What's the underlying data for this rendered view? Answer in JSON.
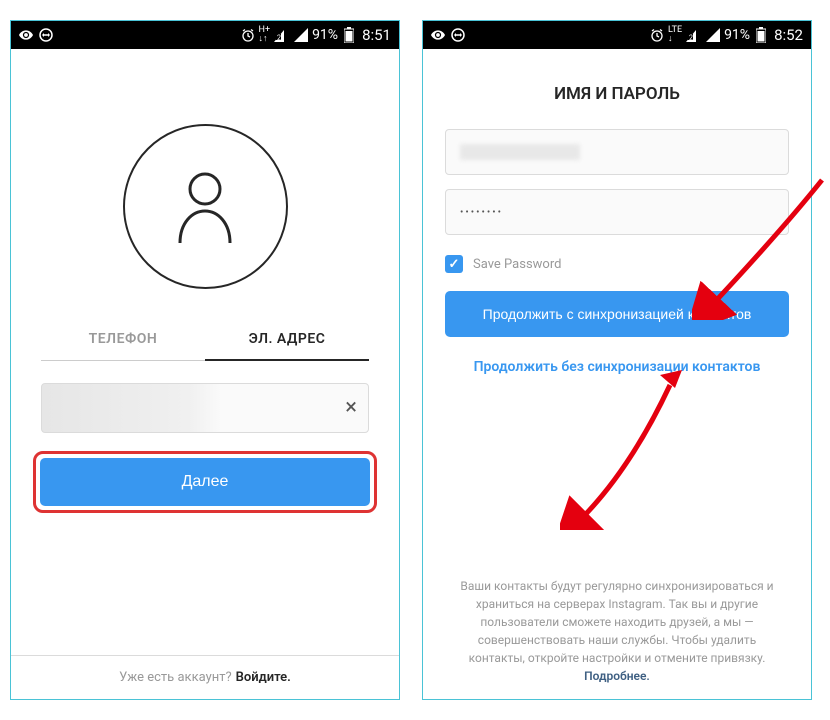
{
  "left": {
    "status": {
      "battery": "91%",
      "time": "8:51"
    },
    "tabs": {
      "phone": "ТЕЛЕФОН",
      "email": "ЭЛ. АДРЕС"
    },
    "input_placeholder": "",
    "next_button": "Далее",
    "footer_text": "Уже есть аккаунт?",
    "footer_link": "Войдите."
  },
  "right": {
    "status": {
      "battery": "91%",
      "time": "8:52"
    },
    "heading": "ИМЯ И ПАРОЛЬ",
    "password_dots": "••••••••",
    "save_password_label": "Save Password",
    "continue_sync": "Продолжить с синхронизацией контактов",
    "continue_no_sync": "Продолжить без синхронизации контактов",
    "disclaimer_text": "Ваши контакты будут регулярно синхронизироваться и храниться на серверах Instagram. Так вы и другие пользователи сможете находить друзей, а мы — совершенствовать наши службы. Чтобы удалить контакты, откройте настройки и отмените привязку.",
    "disclaimer_link": "Подробнее."
  }
}
